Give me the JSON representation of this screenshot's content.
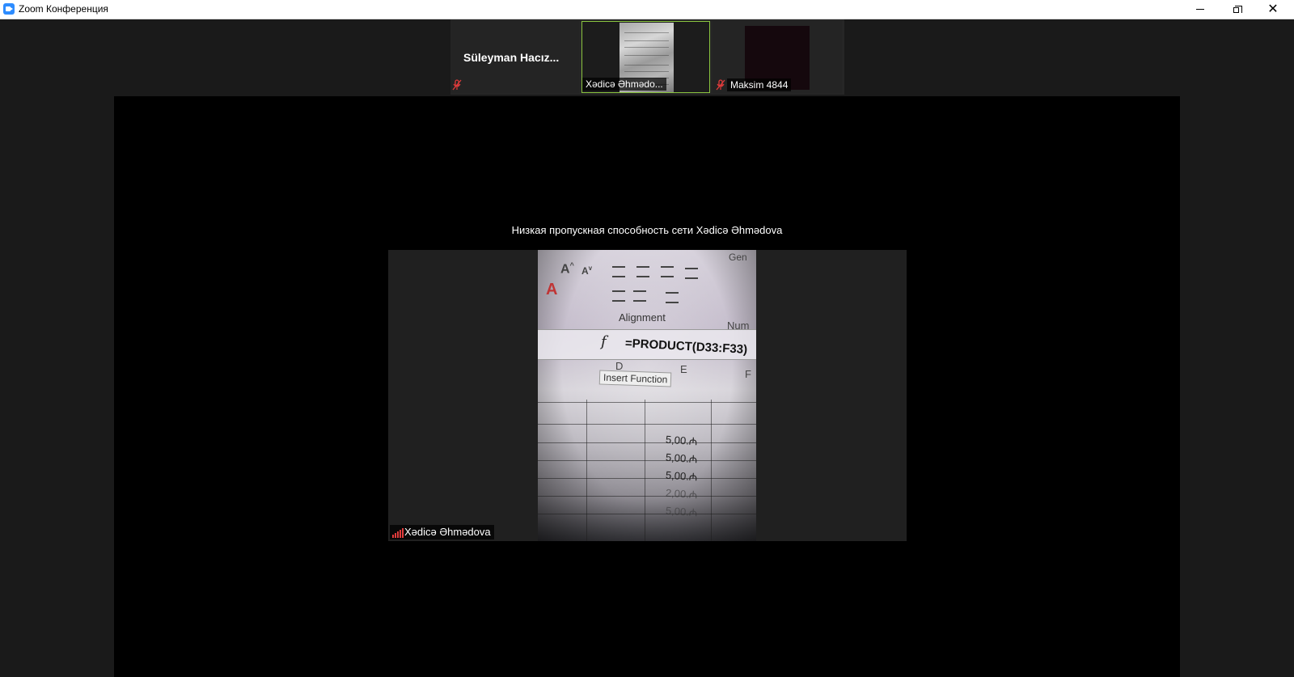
{
  "window": {
    "title": "Zoom Конференция",
    "controls": {
      "minimize": "minimize-icon",
      "restore": "restore-icon",
      "close": "close-icon",
      "close_glyph": "✕"
    }
  },
  "thumbnails": [
    {
      "name": "Süleyman  Hacız...",
      "muted": true,
      "video": false
    },
    {
      "name": "Xədicə Əhmədo...",
      "muted": false,
      "video": true,
      "active_speaker": true
    },
    {
      "name": "Maksim 4844",
      "muted": true,
      "video": true
    }
  ],
  "stage": {
    "bandwidth_notice": "Низкая пропускная способность сети Xədicə Əhmədova",
    "participant_label": "Xədicə Əhmədova",
    "signal_icon": "network-signal-icon",
    "signal_color": "#e03b3b"
  },
  "video_content": {
    "ribbon_group": "Alignment",
    "number_group_partial": "Num",
    "general_partial": "Gen",
    "formula": "=PRODUCT(D33:F33)",
    "fx_symbol": "f",
    "tooltip": "Insert Function",
    "column_d": "D",
    "column_e": "E",
    "column_f": "F",
    "cell_values": [
      "5,00.₼",
      "5,00.₼",
      "5,00.₼",
      "2,00.₼",
      "5,00.₼"
    ]
  },
  "colors": {
    "active_speaker_border": "#8ac43f",
    "muted_mic": "#e03b3b",
    "background": "#1a1a1a",
    "stage": "#000000"
  }
}
